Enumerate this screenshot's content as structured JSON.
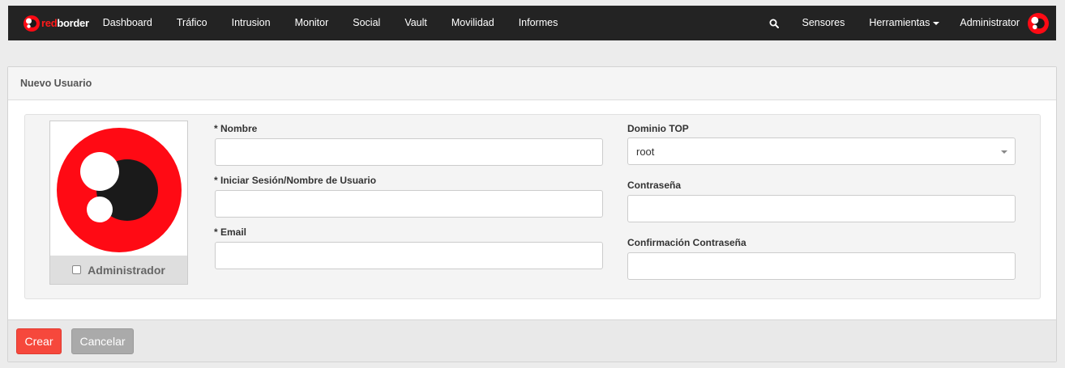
{
  "navbar": {
    "brand_prefix": "red",
    "brand_suffix": "border",
    "items": [
      "Dashboard",
      "Tráfico",
      "Intrusion",
      "Monitor",
      "Social",
      "Vault",
      "Movilidad",
      "Informes"
    ],
    "right": {
      "sensors": "Sensores",
      "tools": "Herramientas",
      "user": "Administrator"
    }
  },
  "panel": {
    "title": "Nuevo Usuario"
  },
  "avatar": {
    "admin_label": "Administrador",
    "admin_checked": false
  },
  "form": {
    "name_label": "* Nombre",
    "name_value": "",
    "login_label": "* Iniciar Sesión/Nombre de Usuario",
    "login_value": "",
    "email_label": "* Email",
    "email_value": "",
    "domain_label": "Dominio TOP",
    "domain_value": "root",
    "password_label": "Contraseña",
    "password_value": "",
    "password_confirm_label": "Confirmación Contraseña",
    "password_confirm_value": ""
  },
  "footer": {
    "create_label": "Crear",
    "cancel_label": "Cancelar"
  },
  "colors": {
    "brand_red": "#ff1a1a",
    "navbar_bg": "#232323",
    "create_button": "#f6483c",
    "cancel_button": "#aaaaaa"
  },
  "icons": {
    "search": "search-icon",
    "tools_dropdown": "chevron-down-icon",
    "logo": "redborder-logo-icon"
  }
}
